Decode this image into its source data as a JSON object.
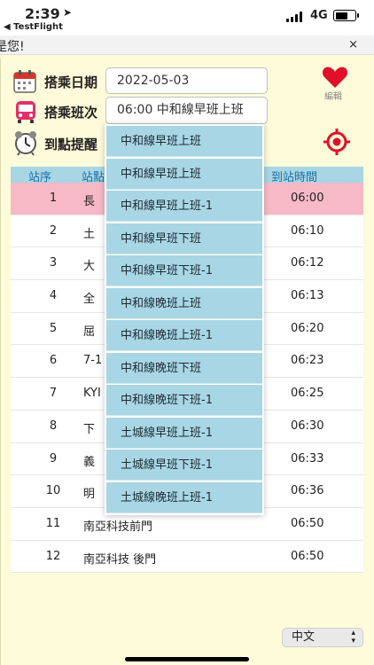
{
  "status_bar": {
    "time": "2:39",
    "back_app": "◀ TestFlight",
    "network": "4G"
  },
  "banner": {
    "text": "是您!",
    "close": "×"
  },
  "form": {
    "date_label": "搭乘日期",
    "date_value": "2022-05-03",
    "shift_label": "搭乘班次",
    "shift_value": "06:00 中和線早班上班",
    "alarm_label": "到點提醒",
    "edit_label": "編輯"
  },
  "table": {
    "headers": [
      "站序",
      "站點",
      "到站時間"
    ],
    "rows": [
      {
        "seq": "1",
        "stop": "長",
        "time": "06:00",
        "active": true
      },
      {
        "seq": "2",
        "stop": "土",
        "time": "06:10"
      },
      {
        "seq": "3",
        "stop": "大",
        "time": "06:12"
      },
      {
        "seq": "4",
        "stop": "全",
        "time": "06:13"
      },
      {
        "seq": "5",
        "stop": "屈",
        "time": "06:20"
      },
      {
        "seq": "6",
        "stop": "7-1",
        "time": "06:23"
      },
      {
        "seq": "7",
        "stop": "KYI",
        "time": "06:25"
      },
      {
        "seq": "8",
        "stop": "下",
        "time": "06:30"
      },
      {
        "seq": "9",
        "stop": "義",
        "time": "06:33"
      },
      {
        "seq": "10",
        "stop": "明",
        "time": "06:36"
      },
      {
        "seq": "11",
        "stop": "南亞科技前門",
        "time": "06:50"
      },
      {
        "seq": "12",
        "stop": "南亞科技 後門",
        "time": "06:50"
      }
    ]
  },
  "dropdown": {
    "options": [
      "中和線早班上班",
      "中和線早班上班",
      "中和線早班上班-1",
      "中和線早班下班",
      "中和線早班下班-1",
      "中和線晚班上班",
      "中和線晚班上班-1",
      "中和線晚班下班",
      "中和線晚班下班-1",
      "土城線早班上班-1",
      "土城線早班下班-1",
      "土城線晚班上班-1"
    ]
  },
  "language": {
    "selected": "中文"
  },
  "colors": {
    "background": "#fdfbd9",
    "header_blue": "#a8d6e4",
    "active_pink": "#f7b9c6",
    "accent_red": "#e0102a"
  },
  "icons": {
    "calendar": "calendar-icon",
    "bus": "bus-icon",
    "alarm": "alarm-clock-icon",
    "heart": "heart-icon",
    "target": "target-icon"
  }
}
